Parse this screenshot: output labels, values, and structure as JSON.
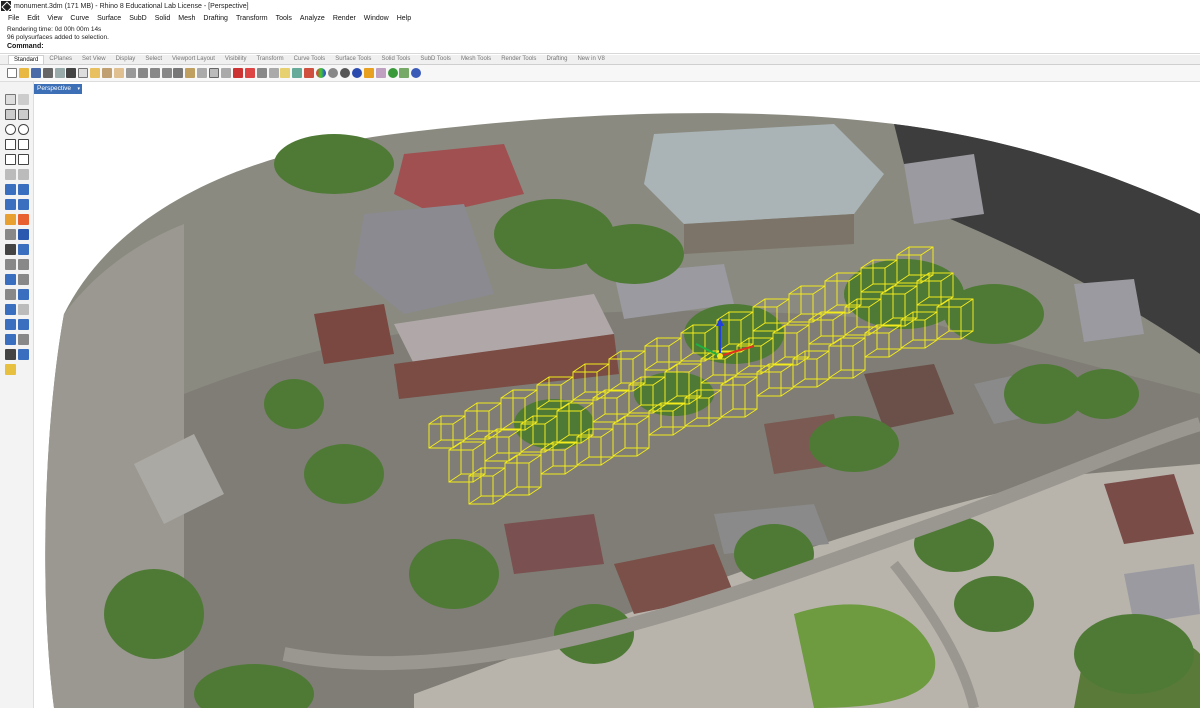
{
  "window": {
    "title": "monument.3dm (171 MB) - Rhino 8 Educational Lab License - [Perspective]",
    "app_icon": "rhino-logo-icon"
  },
  "menu": [
    "File",
    "Edit",
    "View",
    "Curve",
    "Surface",
    "SubD",
    "Solid",
    "Mesh",
    "Drafting",
    "Transform",
    "Tools",
    "Analyze",
    "Render",
    "Window",
    "Help"
  ],
  "command_history": [
    "Rendering time: 0d 00h 00m 14s",
    "96 polysurfaces added to selection."
  ],
  "command_prompt": "Command:",
  "toolbar_tabs": [
    "Standard",
    "CPlanes",
    "Set View",
    "Display",
    "Select",
    "Viewport Layout",
    "Visibility",
    "Transform",
    "Curve Tools",
    "Surface Tools",
    "Solid Tools",
    "SubD Tools",
    "Mesh Tools",
    "Render Tools",
    "Drafting",
    "New in V8"
  ],
  "active_tab": "Standard",
  "viewport": {
    "label": "Perspective",
    "selection_color": "#f2ea1a"
  },
  "colors": {
    "viewport_tab": "#3d6fb6",
    "selection": "#f2ea1a",
    "gumball_x": "#e03020",
    "gumball_y": "#20b040",
    "gumball_z": "#2040e0"
  }
}
